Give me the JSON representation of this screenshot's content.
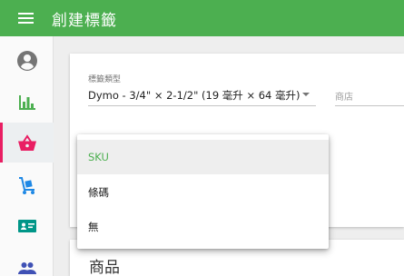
{
  "appbar": {
    "title": "創建標籤",
    "color": "#4caf50"
  },
  "sidebar": {
    "items": [
      {
        "name": "account",
        "icon": "account-circle-icon",
        "color": "#757575"
      },
      {
        "name": "reports",
        "icon": "bar-chart-icon",
        "color": "#4caf50"
      },
      {
        "name": "shop",
        "icon": "basket-icon",
        "color": "#e91e63",
        "active": true
      },
      {
        "name": "delivery",
        "icon": "hand-truck-icon",
        "color": "#1e88e5"
      },
      {
        "name": "contacts",
        "icon": "id-card-icon",
        "color": "#009688"
      },
      {
        "name": "users",
        "icon": "people-icon",
        "color": "#3f51b5"
      }
    ]
  },
  "form": {
    "label_type": {
      "label": "標籤類型",
      "value": "Dymo - 3/4\" × 2-1/2\" (19 毫升 × 64 毫升)"
    },
    "store": {
      "label": "商店"
    }
  },
  "dropdown": {
    "options": [
      {
        "label": "SKU",
        "selected": true
      },
      {
        "label": "條碼"
      },
      {
        "label": "無"
      }
    ]
  },
  "products": {
    "title": "商品"
  }
}
